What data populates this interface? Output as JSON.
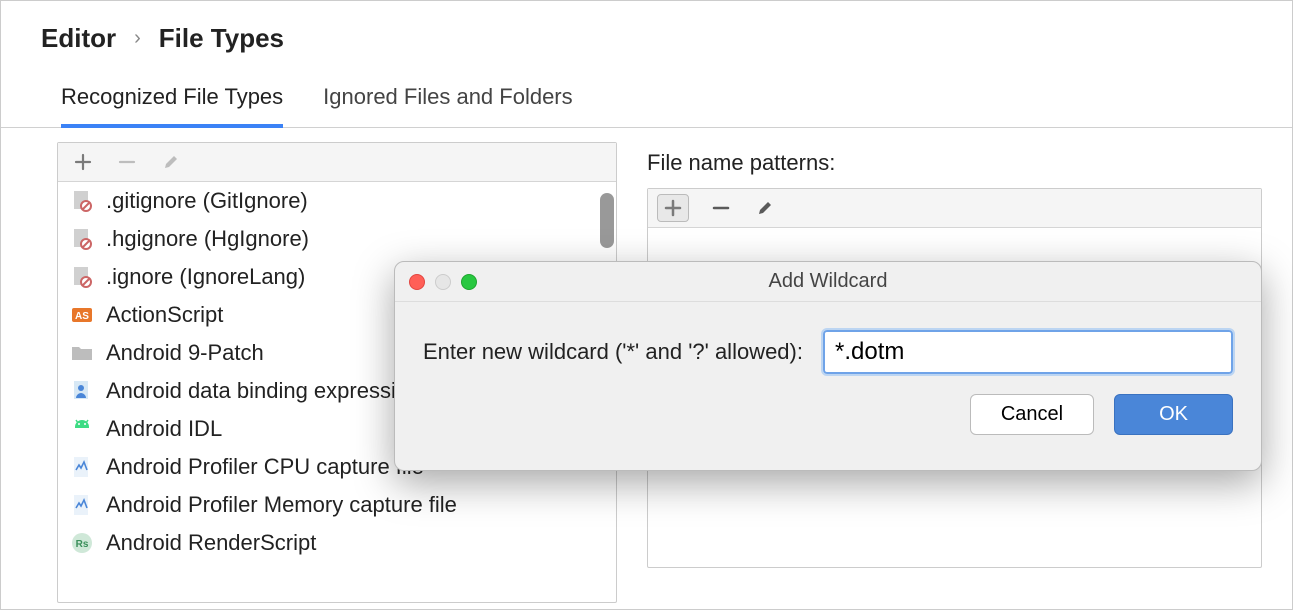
{
  "breadcrumb": {
    "parent": "Editor",
    "current": "File Types"
  },
  "tabs": [
    {
      "label": "Recognized File Types",
      "active": true
    },
    {
      "label": "Ignored Files and Folders",
      "active": false
    }
  ],
  "left_toolbar": {
    "icons": [
      "plus-icon",
      "minus-icon",
      "pencil-icon"
    ]
  },
  "file_types": [
    {
      "label": ".gitignore (GitIgnore)",
      "icon": "file-ignore-icon"
    },
    {
      "label": ".hgignore (HgIgnore)",
      "icon": "file-ignore-icon"
    },
    {
      "label": ".ignore (IgnoreLang)",
      "icon": "file-ignore-icon"
    },
    {
      "label": "ActionScript",
      "icon": "as-icon"
    },
    {
      "label": "Android 9-Patch",
      "icon": "folder-icon"
    },
    {
      "label": "Android data binding expression",
      "icon": "android-person-icon"
    },
    {
      "label": "Android IDL",
      "icon": "android-icon"
    },
    {
      "label": "Android Profiler CPU capture file",
      "icon": "profiler-icon"
    },
    {
      "label": "Android Profiler Memory capture file",
      "icon": "profiler-icon"
    },
    {
      "label": "Android RenderScript",
      "icon": "rs-icon"
    }
  ],
  "right_panel": {
    "header": "File name patterns:",
    "toolbar_icons": [
      "plus-icon",
      "minus-icon",
      "pencil-icon"
    ]
  },
  "dialog": {
    "title": "Add Wildcard",
    "label": "Enter new wildcard ('*' and '?' allowed):",
    "value": "*.dotm",
    "cancel": "Cancel",
    "ok": "OK"
  }
}
